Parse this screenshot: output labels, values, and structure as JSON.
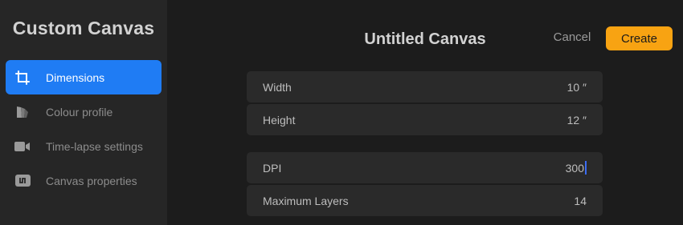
{
  "sidebar": {
    "title": "Custom Canvas",
    "items": [
      {
        "label": "Dimensions",
        "icon": "crop-icon",
        "active": true
      },
      {
        "label": "Colour profile",
        "icon": "colour-profile-icon",
        "active": false
      },
      {
        "label": "Time-lapse settings",
        "icon": "video-camera-icon",
        "active": false
      },
      {
        "label": "Canvas properties",
        "icon": "canvas-properties-icon",
        "active": false
      }
    ]
  },
  "header": {
    "title": "Untitled Canvas",
    "cancel_label": "Cancel",
    "create_label": "Create"
  },
  "fields": {
    "width": {
      "label": "Width",
      "value": "10 ″"
    },
    "height": {
      "label": "Height",
      "value": "12 ″"
    },
    "dpi": {
      "label": "DPI",
      "value": "300"
    },
    "max_layers": {
      "label": "Maximum Layers",
      "value": "14"
    }
  },
  "colors": {
    "accent_blue": "#1f7cf4",
    "create_orange": "#f8a312",
    "background": "#1c1c1c",
    "sidebar": "#262626"
  }
}
